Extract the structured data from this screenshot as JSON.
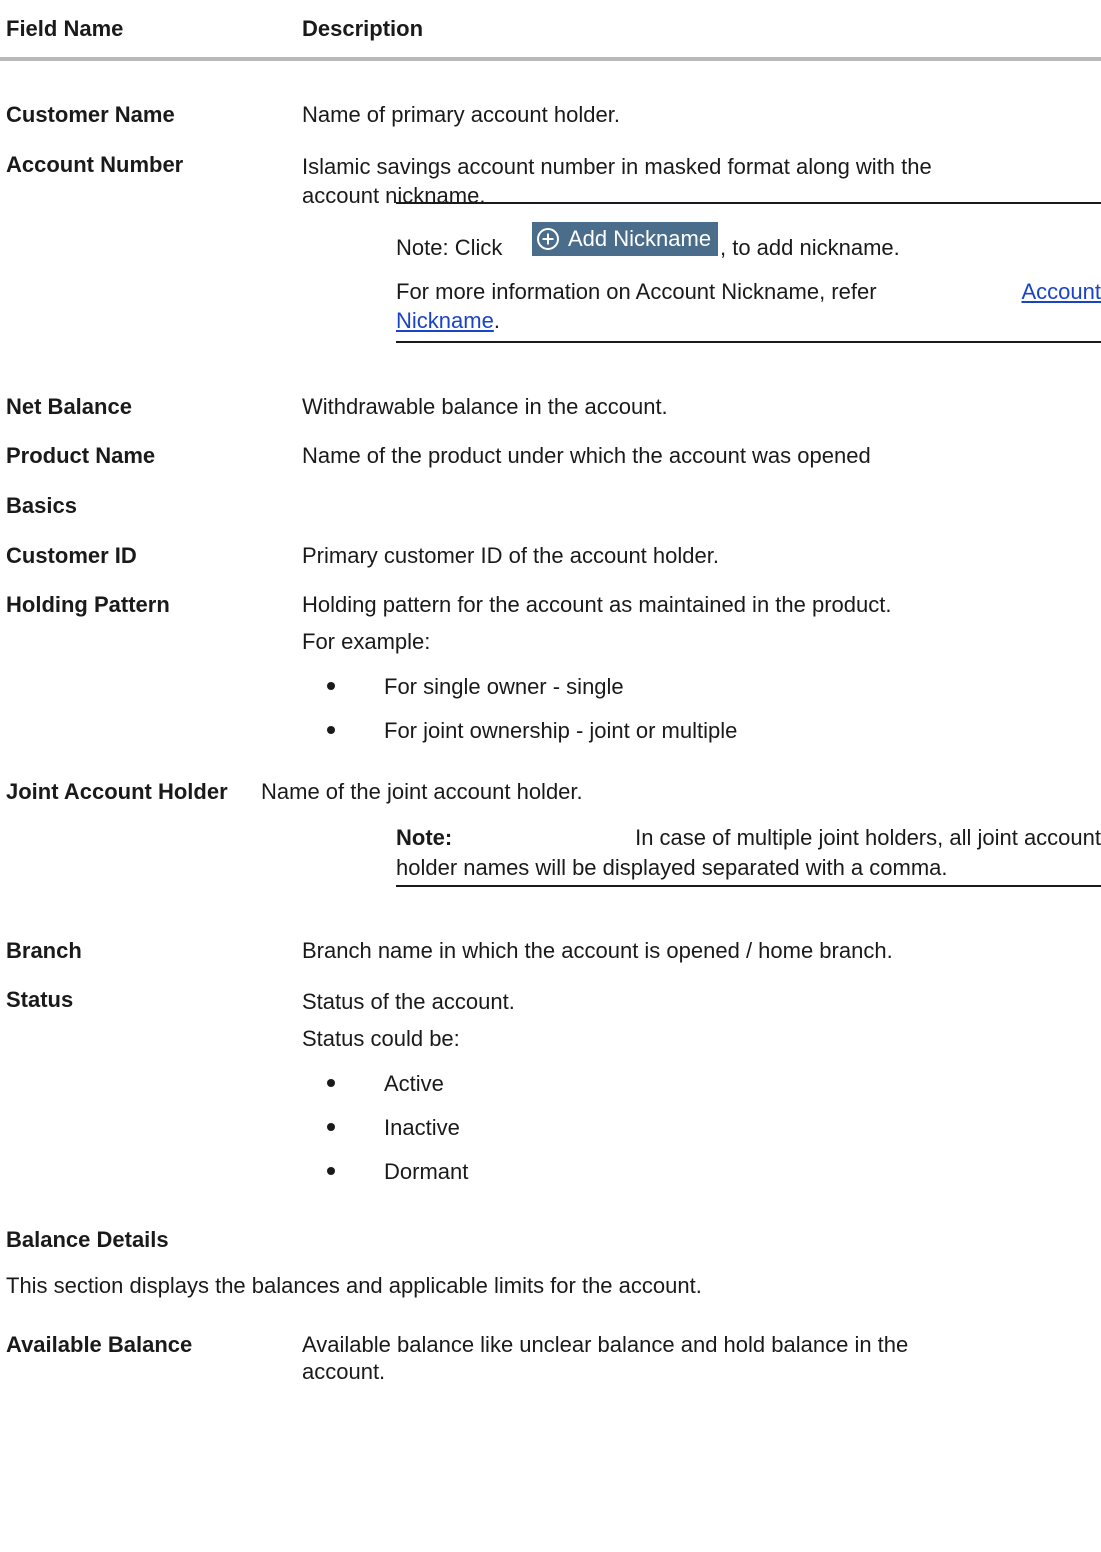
{
  "header": {
    "field_name": "Field Name",
    "description": "Description"
  },
  "rows": {
    "customer_name": {
      "label": "Customer Name",
      "desc": "Name of primary account holder."
    },
    "account_number": {
      "label": "Account Number",
      "desc_line1": "Islamic savings account number in masked format along with the",
      "desc_line2": "account nickname.",
      "note_prefix": "Note: Click",
      "button_label": "Add Nickname",
      "note_suffix": ", to add nickname.",
      "info_line1_text": "For more information on Account Nickname, refer",
      "info_link_part1": "Account",
      "info_link_part2": "Nickname",
      "info_period": "."
    },
    "net_balance": {
      "label": "Net Balance",
      "desc": "Withdrawable balance in the account."
    },
    "product_name": {
      "label": "Product Name",
      "desc": "Name of the product under which the account was opened"
    },
    "basics": {
      "label": "Basics"
    },
    "customer_id": {
      "label": "Customer ID",
      "desc": "Primary customer ID of the account holder."
    },
    "holding_pattern": {
      "label": "Holding Pattern",
      "desc": "Holding pattern for the account as maintained in the product.",
      "example": "For example:",
      "bullets": [
        "For single owner - single",
        "For joint ownership - joint or multiple"
      ]
    },
    "joint_holder": {
      "label": "Joint Account Holder",
      "desc": "Name of the joint account holder.",
      "note_bold": "Note:",
      "note_line1_rest": "In case of multiple joint holders, all joint account",
      "note_line2": "holder names will be displayed separated with a comma."
    },
    "branch": {
      "label": "Branch",
      "desc": "Branch name in which the account is opened / home branch."
    },
    "status": {
      "label": "Status",
      "desc": "Status of the account.",
      "could_be": "Status could be:",
      "bullets": [
        "Active",
        "Inactive",
        "Dormant"
      ]
    }
  },
  "balance_details": {
    "heading": "Balance Details",
    "intro": "This section displays the balances and applicable limits for the account.",
    "available_balance": {
      "label": "Available Balance",
      "desc_line1": "Available balance like unclear balance and hold balance in the",
      "desc_line2": "account."
    }
  },
  "colors": {
    "button_bg": "#4a6d8c",
    "link": "#1a44c8",
    "rule": "#b9b9b9"
  },
  "icons": {
    "add": "plus-circle-icon"
  }
}
